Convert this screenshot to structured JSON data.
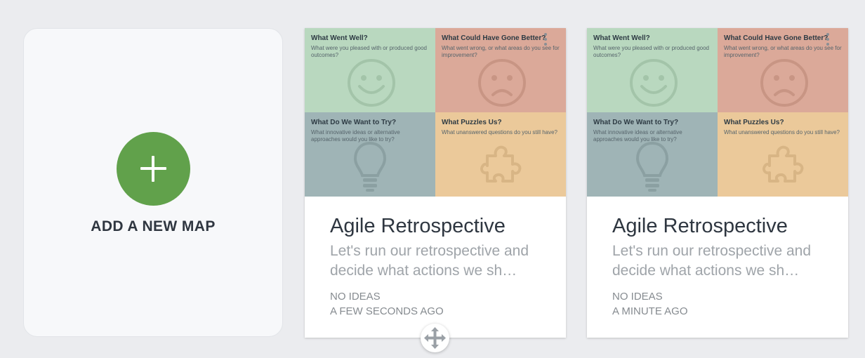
{
  "add_card": {
    "label": "ADD A NEW MAP",
    "icon": "plus-icon",
    "accent": "#61a14b"
  },
  "template": {
    "quadrants": [
      {
        "title": "What Went Well?",
        "subtitle": "What were you pleased with or produced good outcomes?",
        "icon": "smiley-icon",
        "color": "#b9d8bf"
      },
      {
        "title": "What Could Have Gone Better?",
        "subtitle": "What went wrong, or what areas do you see for improvement?",
        "icon": "frown-icon",
        "color": "#dba999"
      },
      {
        "title": "What Do We Want to Try?",
        "subtitle": "What innovative ideas or alternative approaches would you like to try?",
        "icon": "lightbulb-icon",
        "color": "#9fb4b6"
      },
      {
        "title": "What Puzzles Us?",
        "subtitle": "What unanswered questions do you still have?",
        "icon": "puzzle-icon",
        "color": "#ebc99a"
      }
    ]
  },
  "maps": [
    {
      "title": "Agile Retrospective",
      "description": "Let's run our retrospective and decide what actions we sh…",
      "ideas": "NO IDEAS",
      "time": "A FEW SECONDS AGO"
    },
    {
      "title": "Agile Retrospective",
      "description": "Let's run our retrospective and decide what actions we sh…",
      "ideas": "NO IDEAS",
      "time": "A MINUTE AGO"
    }
  ],
  "drag_handle": {
    "icon": "move-arrows-icon"
  }
}
